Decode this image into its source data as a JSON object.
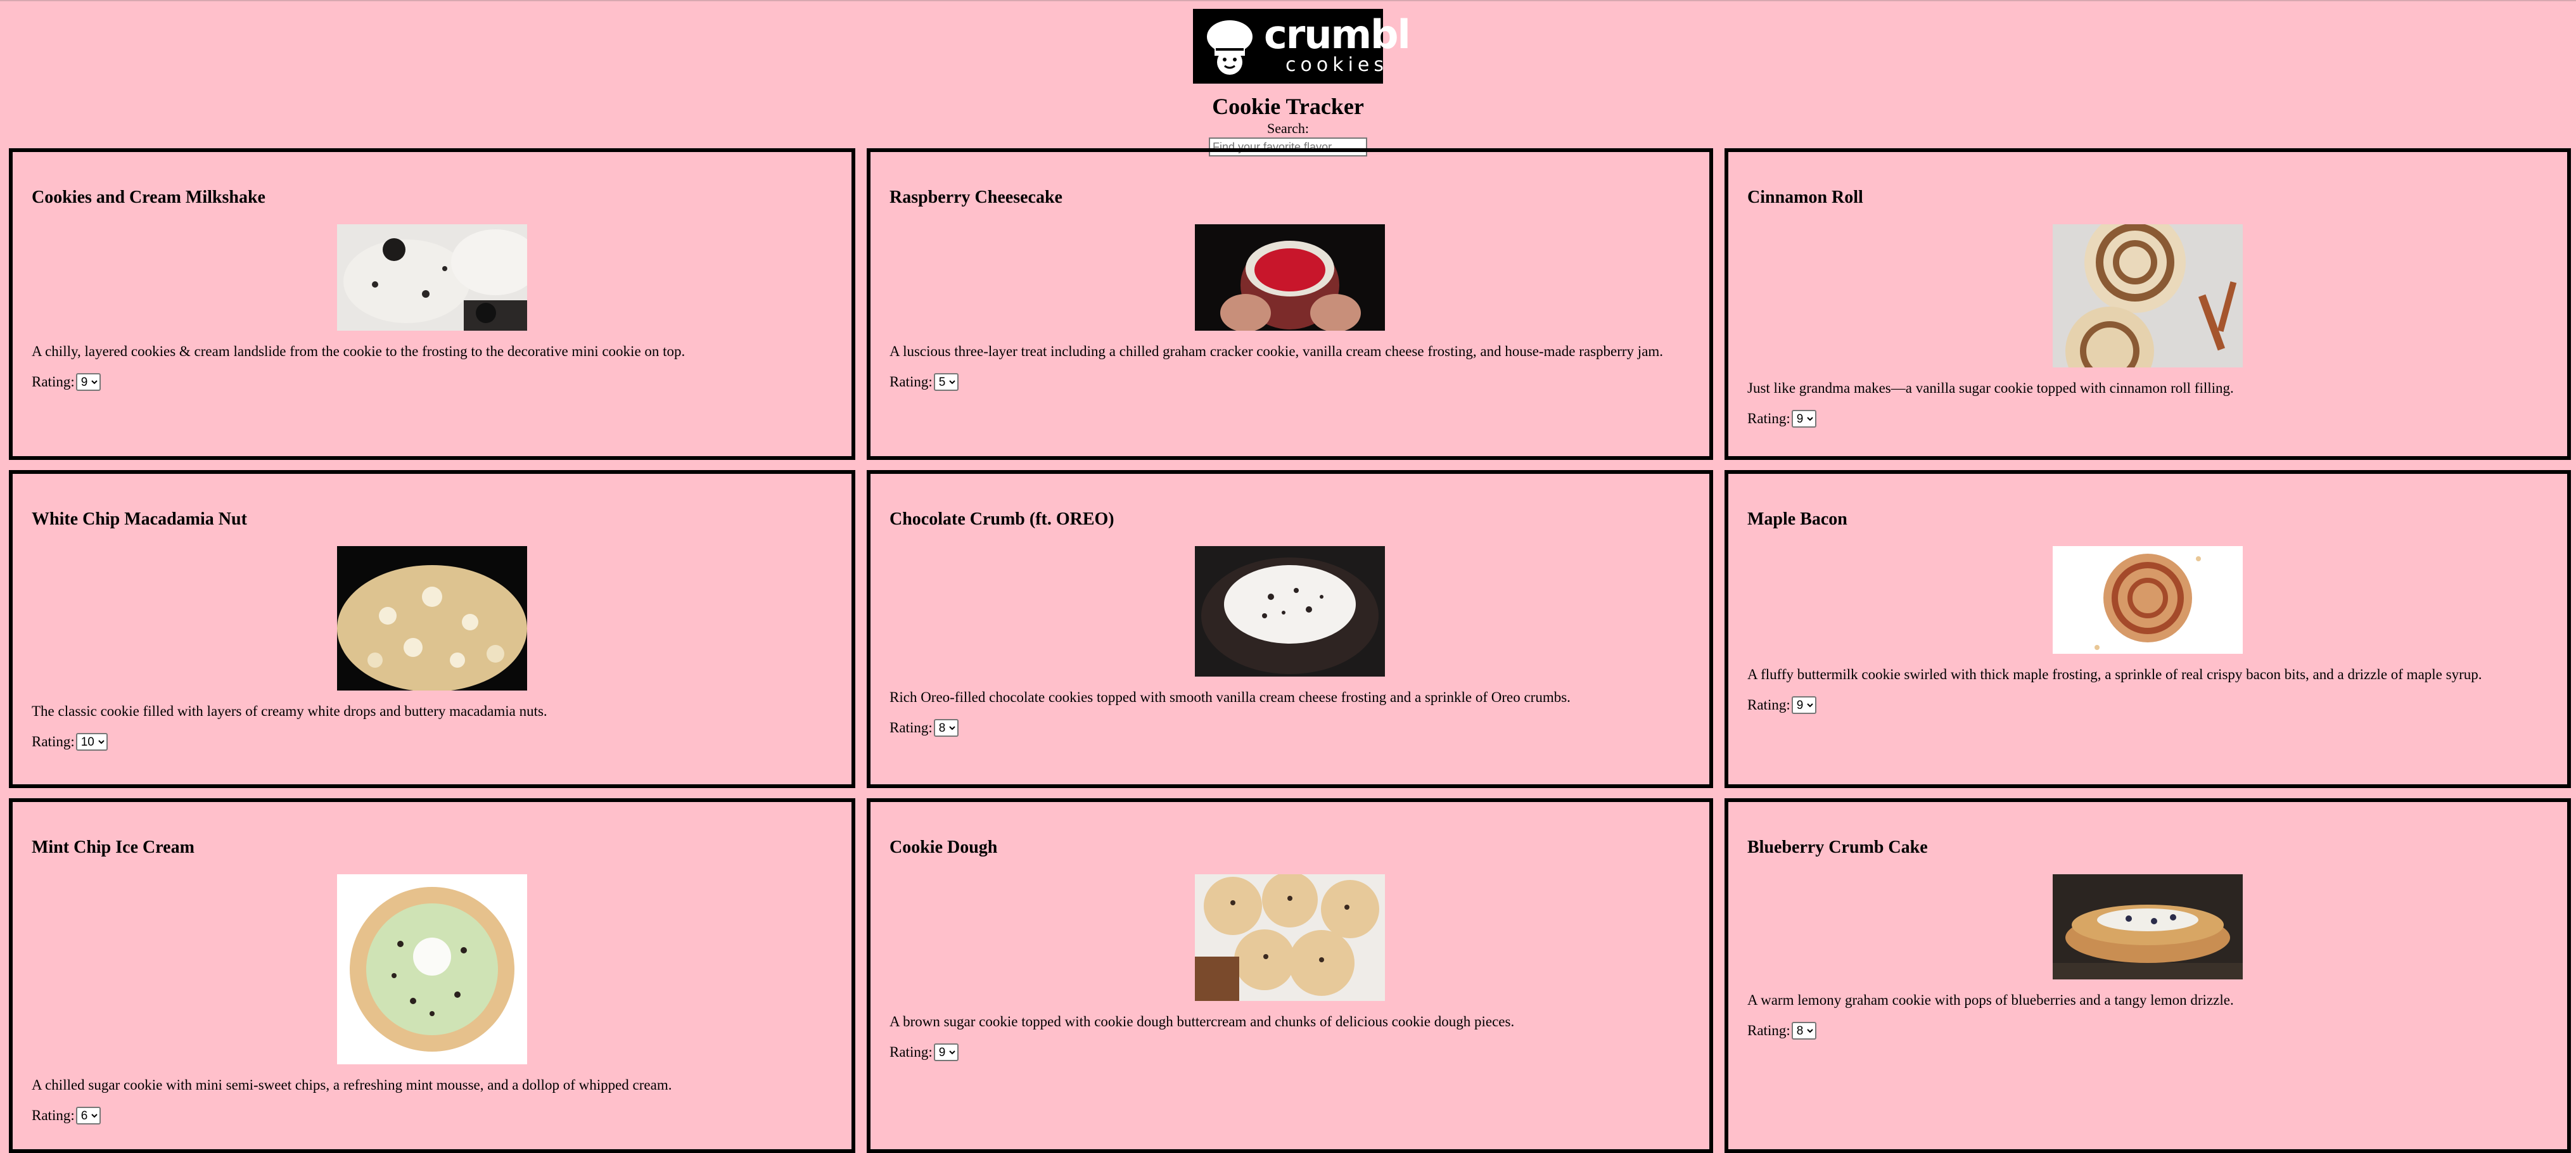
{
  "header": {
    "logo_brand": "crumbl",
    "logo_sub": "cookies",
    "title": "Cookie Tracker",
    "search_label": "Search:",
    "search_placeholder": "Find your favorite flavor"
  },
  "rating_label": "Rating:",
  "cookies": [
    {
      "name": "Cookies and Cream Milkshake",
      "description": "A chilly, layered cookies & cream landslide from the cookie to the frosting to the decorative mini cookie on top.",
      "rating": "9"
    },
    {
      "name": "Raspberry Cheesecake",
      "description": "A luscious three-layer treat including a chilled graham cracker cookie, vanilla cream cheese frosting, and house-made raspberry jam.",
      "rating": "5"
    },
    {
      "name": "Cinnamon Roll",
      "description": "Just like grandma makes—a vanilla sugar cookie topped with cinnamon roll filling.",
      "rating": "9"
    },
    {
      "name": "White Chip Macadamia Nut",
      "description": "The classic cookie filled with layers of creamy white drops and buttery macadamia nuts.",
      "rating": "10"
    },
    {
      "name": "Chocolate Crumb (ft. OREO)",
      "description": "Rich Oreo-filled chocolate cookies topped with smooth vanilla cream cheese frosting and a sprinkle of Oreo crumbs.",
      "rating": "8"
    },
    {
      "name": "Maple Bacon",
      "description": "A fluffy buttermilk cookie swirled with thick maple frosting, a sprinkle of real crispy bacon bits, and a drizzle of maple syrup.",
      "rating": "9"
    },
    {
      "name": "Mint Chip Ice Cream",
      "description": "A chilled sugar cookie with mini semi-sweet chips, a refreshing mint mousse, and a dollop of whipped cream.",
      "rating": "6"
    },
    {
      "name": "Cookie Dough",
      "description": "A brown sugar cookie topped with cookie dough buttercream and chunks of delicious cookie dough pieces.",
      "rating": "9"
    },
    {
      "name": "Blueberry Crumb Cake",
      "description": "A warm lemony graham cookie with pops of blueberries and a tangy lemon drizzle.",
      "rating": "8"
    }
  ],
  "colors": {
    "background": "#ffc0cb",
    "card_border": "#000000",
    "logo_bg": "#000000"
  }
}
